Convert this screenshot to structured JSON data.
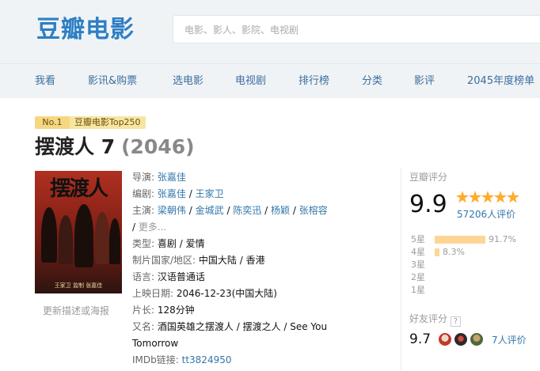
{
  "logo": "豆瓣电影",
  "search": {
    "placeholder": "电影、影人、影院、电视剧"
  },
  "nav": [
    "我看",
    "影讯&购票",
    "选电影",
    "电视剧",
    "排行榜",
    "分类",
    "影评",
    "2045年度榜单"
  ],
  "badge": {
    "rank": "No.1",
    "list": "豆瓣电影Top250"
  },
  "title": {
    "name": "摆渡人 7",
    "year": "(2046)"
  },
  "poster": {
    "title_art": "摆渡人",
    "caption": "王家卫 监制 张嘉佳"
  },
  "update_link": "更新描述或海报",
  "info": {
    "director_label": "导演:",
    "director": "张嘉佳",
    "writer_label": "编剧:",
    "writers": [
      "张嘉佳",
      "王家卫"
    ],
    "cast_label": "主演:",
    "cast": [
      "梁朝伟",
      "金城武",
      "陈奕迅",
      "杨颖",
      "张榕容"
    ],
    "more": "更多...",
    "genre_label": "类型:",
    "genres": [
      "喜剧",
      "爱情"
    ],
    "country_label": "制片国家/地区:",
    "country": "中国大陆 / 香港",
    "language_label": "语言:",
    "language": "汉语普通话",
    "release_label": "上映日期:",
    "release": "2046-12-23(中国大陆)",
    "runtime_label": "片长:",
    "runtime": "128分钟",
    "aka_label": "又名:",
    "aka_line1": "酒国英雄之摆渡人 / 摆渡之人 / See You",
    "aka_line2": "Tomorrow",
    "imdb_label": "IMDb链接:",
    "imdb": "tt3824950"
  },
  "rating": {
    "header": "豆瓣评分",
    "score": "9.9",
    "stars": 5,
    "votes": "57206人评价",
    "distribution": [
      {
        "label": "5星",
        "percent": 91.7,
        "text": "91.7%"
      },
      {
        "label": "4星",
        "percent": 8.3,
        "text": "8.3%"
      },
      {
        "label": "3星",
        "percent": 0,
        "text": ""
      },
      {
        "label": "2星",
        "percent": 0,
        "text": ""
      },
      {
        "label": "1星",
        "percent": 0,
        "text": ""
      }
    ],
    "friend_header": "好友评分",
    "friend_help": "?",
    "friend_score": "9.7",
    "friend_count": "7人评价"
  },
  "colors": {
    "brand": "#2e7fc4",
    "link": "#3377aa",
    "star": "#ffac2d",
    "bar": "#ffd596"
  }
}
